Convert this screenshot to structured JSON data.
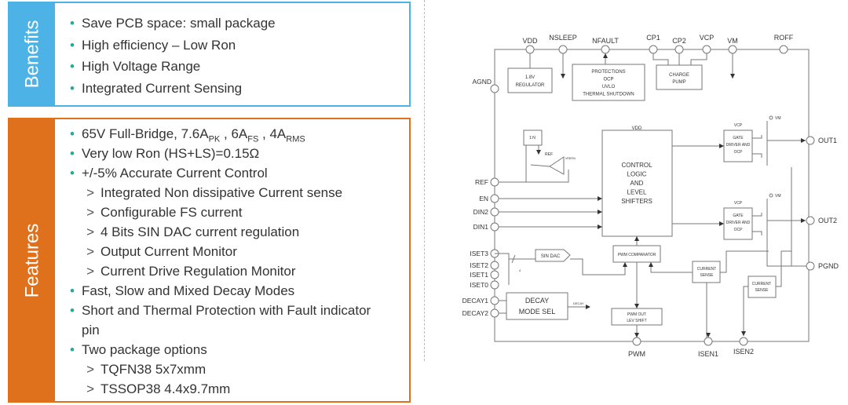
{
  "benefits": {
    "title": "Benefits",
    "color": "#4db3e6",
    "items": [
      "Save PCB space: small package",
      "High efficiency – Low Ron",
      "High Voltage Range",
      "Integrated Current Sensing"
    ]
  },
  "features": {
    "title": "Features",
    "color": "#e0711c",
    "items": [
      {
        "t": "65V Full-Bridge, 7.6A",
        "s1": "PK",
        "t2": " , 6A",
        "s2": "FS",
        "t3": " , 4A",
        "s3": "RMS"
      },
      {
        "t": "Very low Ron (HS+LS)=0.15Ω"
      },
      {
        "t": "+/-5% Accurate Current Control"
      },
      {
        "t": "Integrated Non dissipative Current sense",
        "sub": true
      },
      {
        "t": "Configurable FS current",
        "sub": true
      },
      {
        "t": "4 Bits SIN DAC current regulation",
        "sub": true
      },
      {
        "t": "Output Current Monitor",
        "sub": true
      },
      {
        "t": "Current Drive Regulation Monitor",
        "sub": true
      },
      {
        "t": "Fast, Slow and Mixed Decay Modes"
      },
      {
        "t": "Short and Thermal Protection with Fault indicator"
      },
      {
        "t": "pin",
        "cont": true
      },
      {
        "t": "Two package options"
      },
      {
        "t": "TQFN38 5x7xmm",
        "sub": true
      },
      {
        "t": "TSSOP38 4.4x9.7mm",
        "sub": true
      }
    ]
  },
  "diagram": {
    "top_pins": [
      "VDD",
      "NSLEEP",
      "NFAULT",
      "CP1",
      "CP2",
      "VCP",
      "VM",
      "ROFF"
    ],
    "left_pins": [
      "AGND",
      "REF",
      "EN",
      "DIN2",
      "DIN1",
      "ISET3",
      "ISET2",
      "ISET1",
      "ISET0",
      "DECAY1",
      "DECAY2"
    ],
    "right_pins": [
      "OUT1",
      "OUT2",
      "PGND"
    ],
    "bottom_pins": [
      "PWM",
      "ISEN1",
      "ISEN2"
    ],
    "regulator": [
      "1.8V",
      "REGULATOR"
    ],
    "protections": [
      "PROTECTIONS",
      "OCP",
      "UVLO",
      "THERMAL SHUTDOWN"
    ],
    "charge_pump": [
      "CHARGE",
      "PUMP"
    ],
    "control": [
      "CONTROL",
      "LOGIC",
      "AND",
      "LEVEL",
      "SHIFTERS"
    ],
    "control_vdd": "VDD",
    "gate_driver": [
      "GATE",
      "DRIVER AND",
      "OCP"
    ],
    "vcp": "VCP",
    "vm": "VM",
    "ratio": "1:N",
    "ref": "REF",
    "vrefin": "VREFIN",
    "sin_dac": "SIN DAC",
    "bus_width": "4",
    "pwm_comparator": "PWM COMPARATOR",
    "current_sense": [
      "CURRENT",
      "SENSE"
    ],
    "decay_mode": [
      "DECAY",
      "MODE SEL"
    ],
    "decay": "DECAY",
    "pwm_out": [
      "PWM OUT",
      "LEV SHIFT"
    ]
  }
}
